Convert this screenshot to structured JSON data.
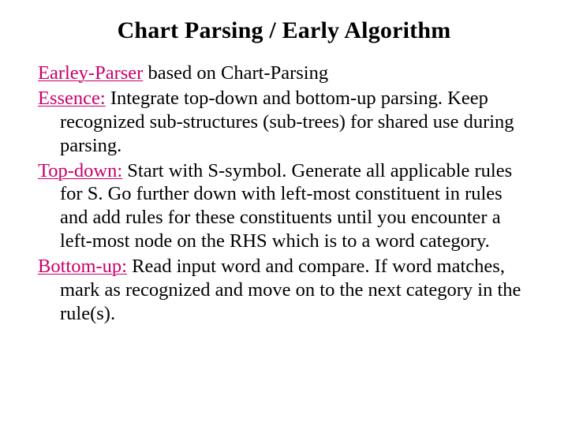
{
  "title": "Chart Parsing / Early Algorithm",
  "intro": {
    "label": "Earley-Parser",
    "text": " based on Chart-Parsing"
  },
  "essence": {
    "label": "Essence:",
    "text": " Integrate top-down and bottom-up parsing. Keep recognized sub-structures (sub-trees) for shared use during parsing."
  },
  "topdown": {
    "label": "Top-down:",
    "text": " Start with S-symbol. Generate all applicable rules for S. Go further down with left-most constituent in rules and add rules for these constituents until you encounter a left-most node on the RHS which is to a word category."
  },
  "bottomup": {
    "label": "Bottom-up:",
    "text": " Read input word and compare. If word matches, mark as recognized and move on to the next category in the rule(s)."
  }
}
